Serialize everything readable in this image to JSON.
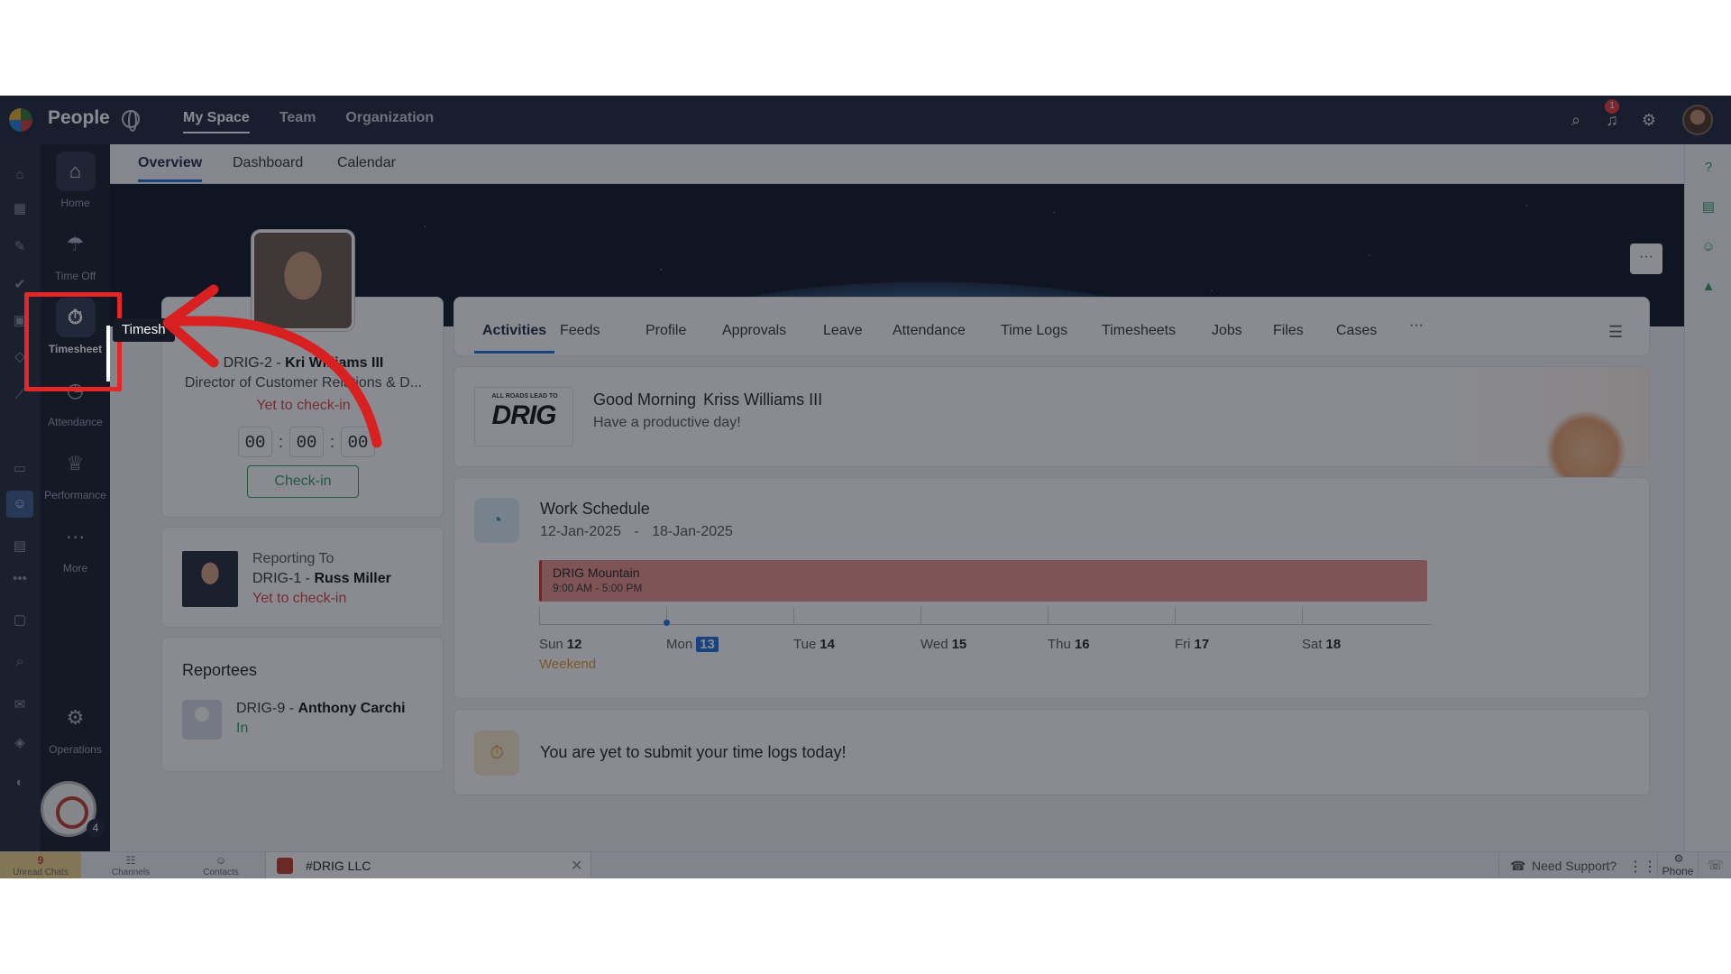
{
  "app": {
    "name": "People"
  },
  "topnav": {
    "items": [
      "My Space",
      "Team",
      "Organization"
    ],
    "active": "My Space",
    "notification_count": "1"
  },
  "modules": [
    {
      "label": "Home",
      "icon": "home-icon"
    },
    {
      "label": "Time Off",
      "icon": "beach-umbrella-icon"
    },
    {
      "label": "Timesheet",
      "icon": "timer-icon",
      "selected": true
    },
    {
      "label": "Attendance",
      "icon": "attendance-icon"
    },
    {
      "label": "Performance",
      "icon": "trophy-icon"
    },
    {
      "label": "More",
      "icon": "more-icon"
    },
    {
      "label": "Operations",
      "icon": "operations-icon"
    }
  ],
  "tooltip": "Timesh",
  "user_avatar_count": "4",
  "subtabs": [
    "Overview",
    "Dashboard",
    "Calendar"
  ],
  "profile": {
    "id_prefix": "DRIG-2 - ",
    "name_visible": "Kri   Williams III",
    "title": "Director of Customer Relations & D...",
    "status": "Yet to check-in",
    "timer": [
      "00",
      "00",
      "00"
    ],
    "checkin_label": "Check-in"
  },
  "reporting": {
    "heading": "Reporting To",
    "id_prefix": "DRIG-1 - ",
    "name": "Russ Miller",
    "status": "Yet to check-in"
  },
  "reportees": {
    "heading": "Reportees",
    "items": [
      {
        "id_prefix": "DRIG-9 - ",
        "name": "Anthony Carchi",
        "status": "In"
      }
    ]
  },
  "activity_tabs": [
    "Activities",
    "Feeds",
    "Profile",
    "Approvals",
    "Leave",
    "Attendance",
    "Time Logs",
    "Timesheets",
    "Jobs",
    "Files",
    "Cases",
    "···"
  ],
  "greeting": {
    "logo_small": "ALL ROADS LEAD TO",
    "logo_big": "DRIG",
    "hello": "Good Morning",
    "name": "Kriss Williams III",
    "sub": "Have a productive day!"
  },
  "work_schedule": {
    "title": "Work Schedule",
    "range_start": "12-Jan-2025",
    "range_sep": "-",
    "range_end": "18-Jan-2025",
    "shift_name": "DRIG Mountain",
    "shift_time": "9:00 AM - 5:00 PM",
    "days": [
      {
        "dow": "Sun",
        "num": "12"
      },
      {
        "dow": "Mon",
        "num": "13",
        "today": true
      },
      {
        "dow": "Tue",
        "num": "14"
      },
      {
        "dow": "Wed",
        "num": "15"
      },
      {
        "dow": "Thu",
        "num": "16"
      },
      {
        "dow": "Fri",
        "num": "17"
      },
      {
        "dow": "Sat",
        "num": "18"
      }
    ],
    "weekend_label": "Weekend"
  },
  "timelog_msg": "You are yet to submit your time logs today!",
  "bottombar": {
    "unread": "Unread Chats",
    "unread_count": "9",
    "channels": "Channels",
    "contacts": "Contacts",
    "chat_title": "#DRIG LLC",
    "support": "Need Support?",
    "phone": "Phone"
  },
  "colors": {
    "highlight": "#e32626",
    "accent": "#1c6fd8",
    "topbar": "#1f2538"
  }
}
